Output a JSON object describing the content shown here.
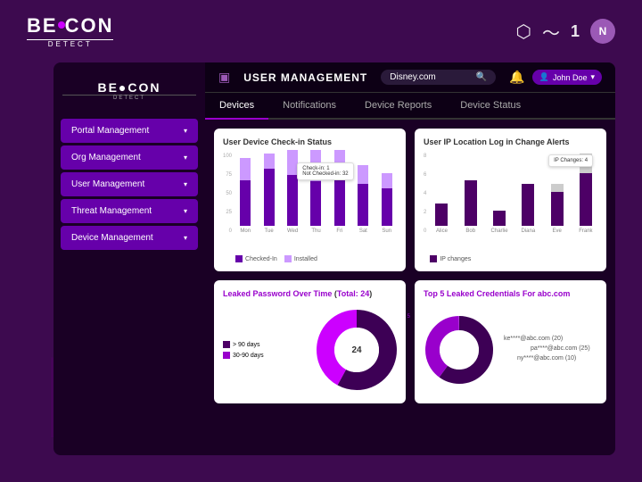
{
  "app": {
    "logo": "BEACON",
    "logo_sub": "DETECT",
    "logo_dot_char": "●"
  },
  "header_icons": [
    "⬡",
    "〜",
    "1",
    "N"
  ],
  "topbar": {
    "icon": "▣",
    "title": "USER MANAGEMENT",
    "search_placeholder": "Disney.com",
    "search_value": "Disney.com",
    "user_label": "John Doe",
    "bell_icon": "🔔"
  },
  "sidebar": {
    "logo": "BEACON",
    "logo_sub": "DETECT",
    "items": [
      {
        "label": "Portal Management",
        "id": "portal-management"
      },
      {
        "label": "Org Management",
        "id": "org-management"
      },
      {
        "label": "User Management",
        "id": "user-management"
      },
      {
        "label": "Threat Management",
        "id": "threat-management"
      },
      {
        "label": "Device Management",
        "id": "device-management"
      }
    ]
  },
  "tabs": [
    {
      "label": "Devices",
      "active": true
    },
    {
      "label": "Notifications",
      "active": false
    },
    {
      "label": "Device Reports",
      "active": false
    },
    {
      "label": "Device Status",
      "active": false
    }
  ],
  "chart1": {
    "title": "User Device Check-in Status",
    "bars": [
      {
        "label": "Mon",
        "checked": 60,
        "installed": 30
      },
      {
        "label": "Tue",
        "checked": 75,
        "installed": 20
      },
      {
        "label": "Wed",
        "checked": 80,
        "installed": 40
      },
      {
        "label": "Thu",
        "checked": 70,
        "installed": 50
      },
      {
        "label": "Fri",
        "checked": 65,
        "installed": 35
      },
      {
        "label": "Sat",
        "checked": 55,
        "installed": 25
      },
      {
        "label": "Sun",
        "checked": 50,
        "installed": 20
      }
    ],
    "tooltip_checked": "Check-in: 1",
    "tooltip_not_checked": "Not Checked-in: 32",
    "legend": [
      {
        "label": "Checked-In",
        "color": "#6600aa"
      },
      {
        "label": "Installed",
        "color": "#cc99ff"
      }
    ],
    "y_labels": [
      "100",
      "75",
      "50",
      "25",
      "0"
    ]
  },
  "chart2": {
    "title": "User IP Location Log in Change Alerts",
    "bars": [
      {
        "label": "Alice",
        "value": 30,
        "gray": 0
      },
      {
        "label": "Bob",
        "value": 60,
        "gray": 0
      },
      {
        "label": "Charlie",
        "value": 20,
        "gray": 0
      },
      {
        "label": "Diana",
        "value": 55,
        "gray": 0
      },
      {
        "label": "Eve",
        "value": 45,
        "gray": 10
      },
      {
        "label": "Frank",
        "value": 70,
        "gray": 25
      }
    ],
    "y_labels": [
      "8",
      "6",
      "4",
      "2",
      "0"
    ],
    "legend": [
      {
        "label": "IP changes",
        "color": "#4d0066"
      }
    ],
    "tooltip": "IP Changes: 4"
  },
  "chart3": {
    "title": "Leaked Password Over Time",
    "total_label": "Total:",
    "total_value": "24",
    "legend": [
      {
        "label": "> 90 days",
        "color": "#4d0066"
      },
      {
        "label": "30-90 days",
        "color": "#9900cc"
      }
    ],
    "segments": [
      {
        "label": "> 90 days",
        "value": 14,
        "color": "#3d0055",
        "percent": 58
      },
      {
        "label": "30-90 days",
        "value": 10,
        "color": "#cc00ff",
        "percent": 42
      }
    ]
  },
  "chart4": {
    "title": "Top 5 Leaked Credentials For",
    "domain": "abc.com",
    "credentials": [
      {
        "email": "ke****@abc.com",
        "count": 20,
        "color": "#555"
      },
      {
        "email": "pa****@abc.com",
        "count": 25,
        "color": "#9900cc"
      },
      {
        "email": "ny****@abc.com",
        "count": 10,
        "color": "#555"
      }
    ]
  }
}
